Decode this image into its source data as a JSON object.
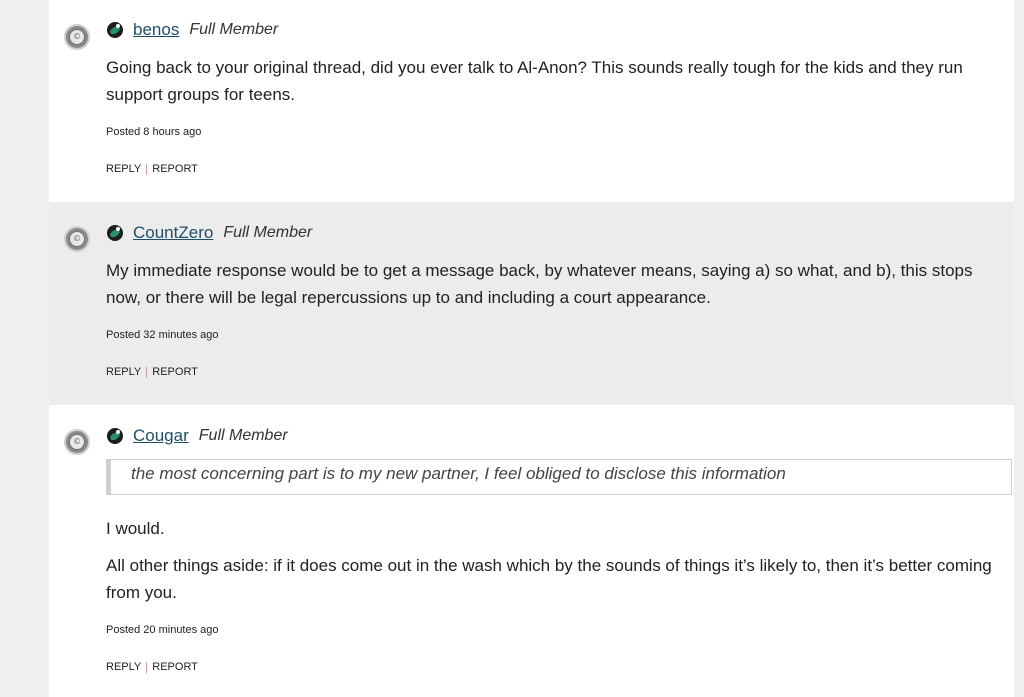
{
  "posts": [
    {
      "username": "benos",
      "rank": "Full Member",
      "paragraphs": [
        "Going back to your original thread, did you ever talk to Al-Anon? This sounds really tough for the kids and they run support groups for teens."
      ],
      "posted": "Posted 8 hours ago",
      "reply_label": "REPLY",
      "report_label": "REPORT"
    },
    {
      "username": "CountZero",
      "rank": "Full Member",
      "paragraphs": [
        "My immediate response would be to get a message back, by whatever means, saying a) so what, and b), this stops now, or there will be legal repercussions up to and including a court appearance."
      ],
      "posted": "Posted 32 minutes ago",
      "reply_label": "REPLY",
      "report_label": "REPORT"
    },
    {
      "username": "Cougar",
      "rank": "Full Member",
      "quote": "the most concerning part is to my new partner, I feel obliged to disclose this information",
      "paragraphs": [
        "I would.",
        "All other things aside: if it does come out in the wash which by the sounds of things it’s likely to, then it’s better coming from you."
      ],
      "posted": "Posted 20 minutes ago",
      "reply_label": "REPLY",
      "report_label": "REPORT"
    }
  ],
  "avatar_glyph": "©",
  "colors": {
    "username_link": "#1f4e66",
    "badge_green": "#2a8f6f",
    "alt_row": "#ececec"
  }
}
